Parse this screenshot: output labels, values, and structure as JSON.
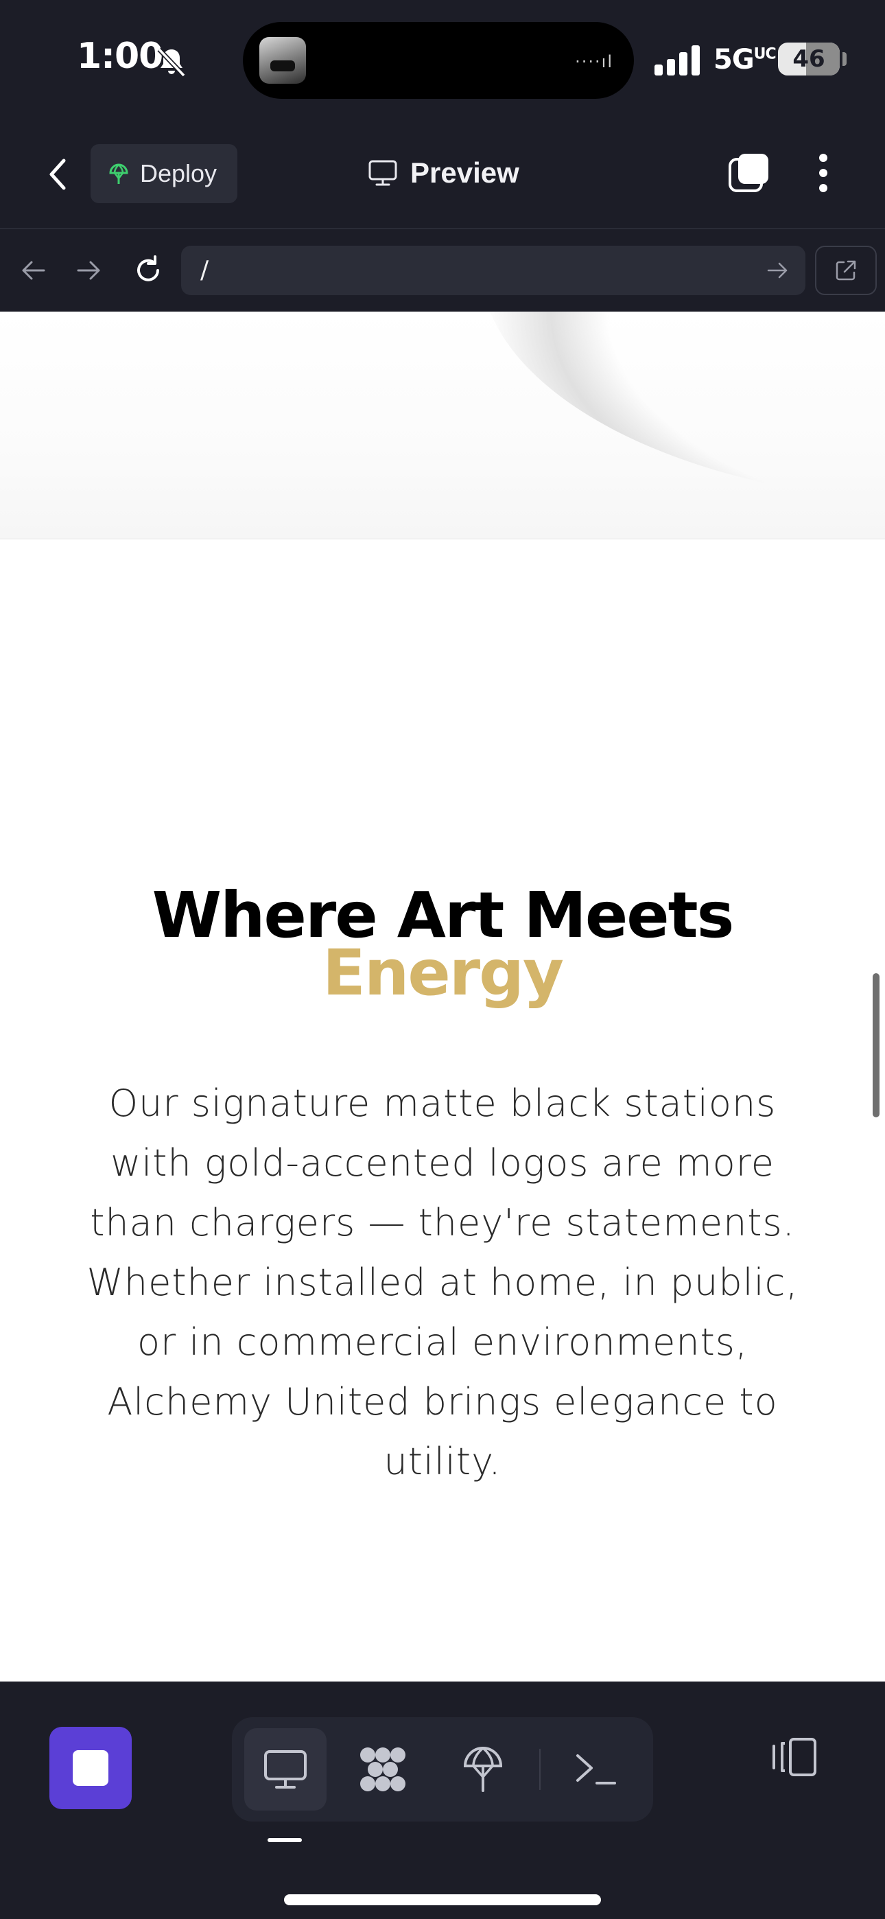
{
  "status_bar": {
    "time": "1:00",
    "network": "5G",
    "network_suffix": "UC",
    "battery": "46",
    "battery_level": 0.46
  },
  "app_bar": {
    "deploy_label": "Deploy",
    "preview_label": "Preview"
  },
  "url_bar": {
    "path": "/"
  },
  "page": {
    "heading_line1": "Where Art Meets",
    "heading_accent": "Energy",
    "body": "Our signature matte black stations with gold-accented logos are more than chargers — they're statements. Whether installed at home, in public, or in commercial environments, Alchemy United brings elegance to utility."
  },
  "colors": {
    "accent_gold": "#d4b56a",
    "stop_button": "#5b3fd6",
    "chrome_background": "#1c1d27",
    "deploy_icon": "#3ecf6e"
  },
  "icons": {
    "status": [
      "bell-slash-icon",
      "signal-icon"
    ],
    "app_bar": [
      "chevron-left-icon",
      "deploy-globe-icon",
      "monitor-icon",
      "tabs-icon",
      "more-vertical-icon"
    ],
    "url_bar": [
      "arrow-left-icon",
      "arrow-right-icon",
      "reload-icon",
      "go-arrow-icon",
      "external-link-icon"
    ],
    "bottom_bar": [
      "stop-icon",
      "monitor-icon",
      "puzzle-icon",
      "deploy-icon",
      "terminal-icon",
      "panel-toggle-icon"
    ]
  }
}
